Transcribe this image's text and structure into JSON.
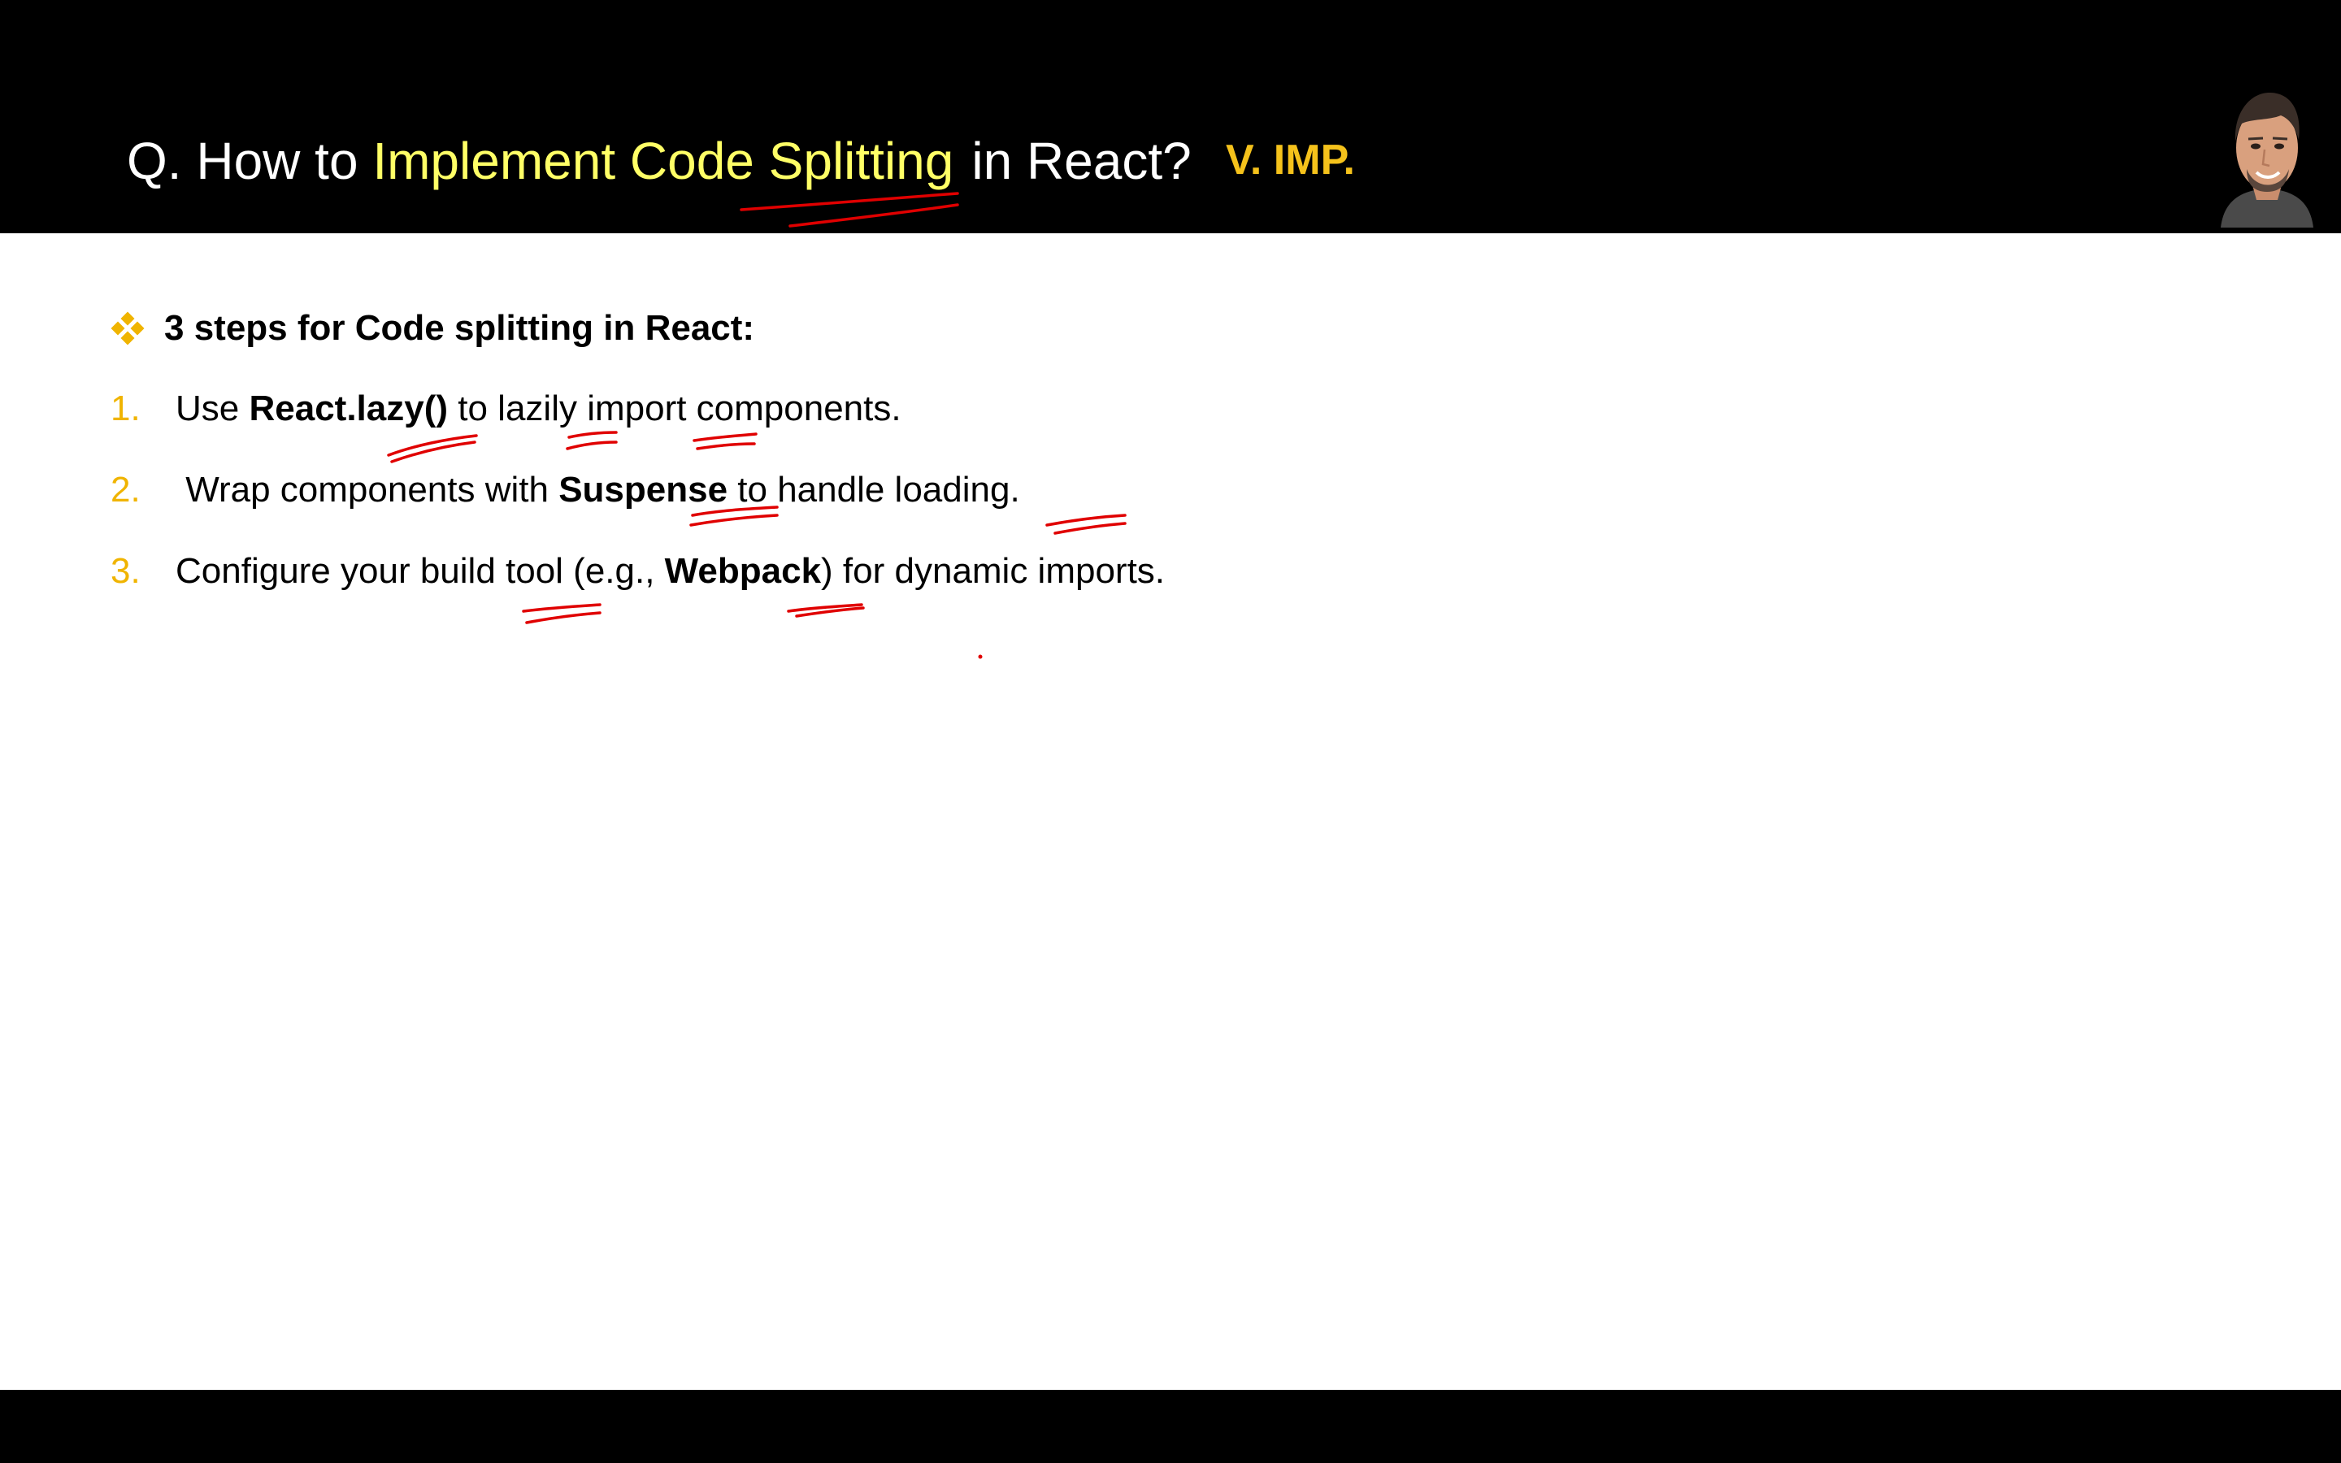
{
  "title": {
    "prefix": "Q. How to ",
    "highlight": "Implement Code Splitting",
    "suffix": "in React?",
    "badge": "V. IMP."
  },
  "heading": "3 steps for Code splitting in React:",
  "steps": [
    {
      "number": "1.",
      "before": "Use ",
      "bold": "React.lazy()",
      "after": " to lazily import components."
    },
    {
      "number": "2.",
      "before": " Wrap components with ",
      "bold": "Suspense",
      "after": " to handle loading."
    },
    {
      "number": "3.",
      "before": "Configure your build tool (e.g., ",
      "bold": "Webpack",
      "after": ") for dynamic imports."
    }
  ],
  "colors": {
    "title_highlight": "#ffff66",
    "badge": "#f5c21b",
    "step_number": "#f0b400",
    "annotation_ink": "#e00000"
  },
  "icons": {
    "heading_bullet": "diamond-bullet-icon",
    "presenter": "presenter-avatar"
  }
}
